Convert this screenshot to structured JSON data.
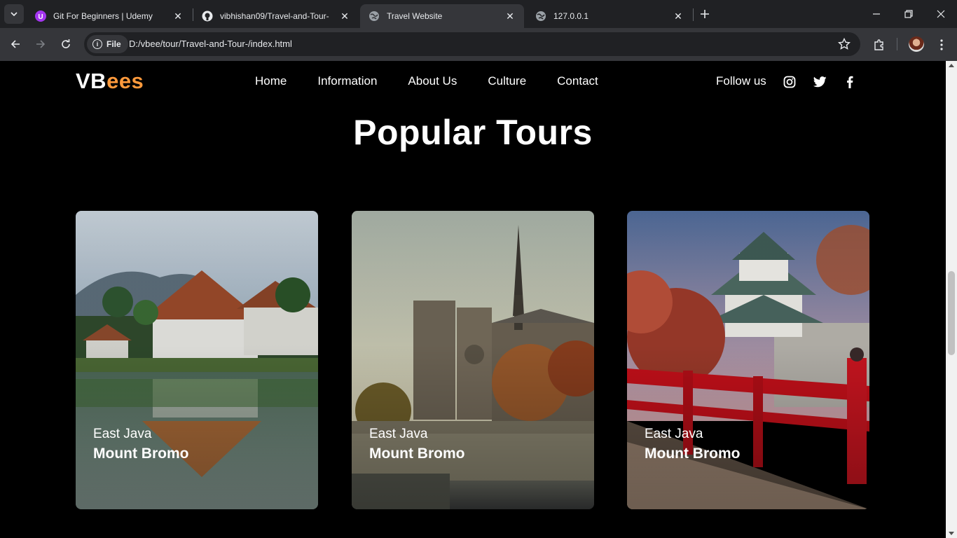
{
  "browser": {
    "tabs": [
      {
        "title": "Git For Beginners | Udemy",
        "icon": "udemy-icon",
        "active": false
      },
      {
        "title": "vibhishan09/Travel-and-Tour-",
        "icon": "github-icon",
        "active": false
      },
      {
        "title": "Travel Website",
        "icon": "globe-icon",
        "active": true
      },
      {
        "title": "127.0.0.1",
        "icon": "globe-icon",
        "active": false
      }
    ],
    "address_chip": "File",
    "url": "D:/vbee/tour/Travel-and-Tour-/index.html"
  },
  "site": {
    "logo_primary": "VB",
    "logo_accent": "ees",
    "accent_color": "#ff9a3c",
    "nav": [
      "Home",
      "Information",
      "About Us",
      "Culture",
      "Contact"
    ],
    "follow_label": "Follow us",
    "social_icons": [
      "instagram-icon",
      "twitter-icon",
      "facebook-icon"
    ]
  },
  "tours": {
    "title": "Popular Tours",
    "cards": [
      {
        "region": "East Java",
        "place": "Mount Bromo",
        "image": "water-palace"
      },
      {
        "region": "East Java",
        "place": "Mount Bromo",
        "image": "cathedral"
      },
      {
        "region": "East Java",
        "place": "Mount Bromo",
        "image": "japanese-castle"
      }
    ]
  }
}
